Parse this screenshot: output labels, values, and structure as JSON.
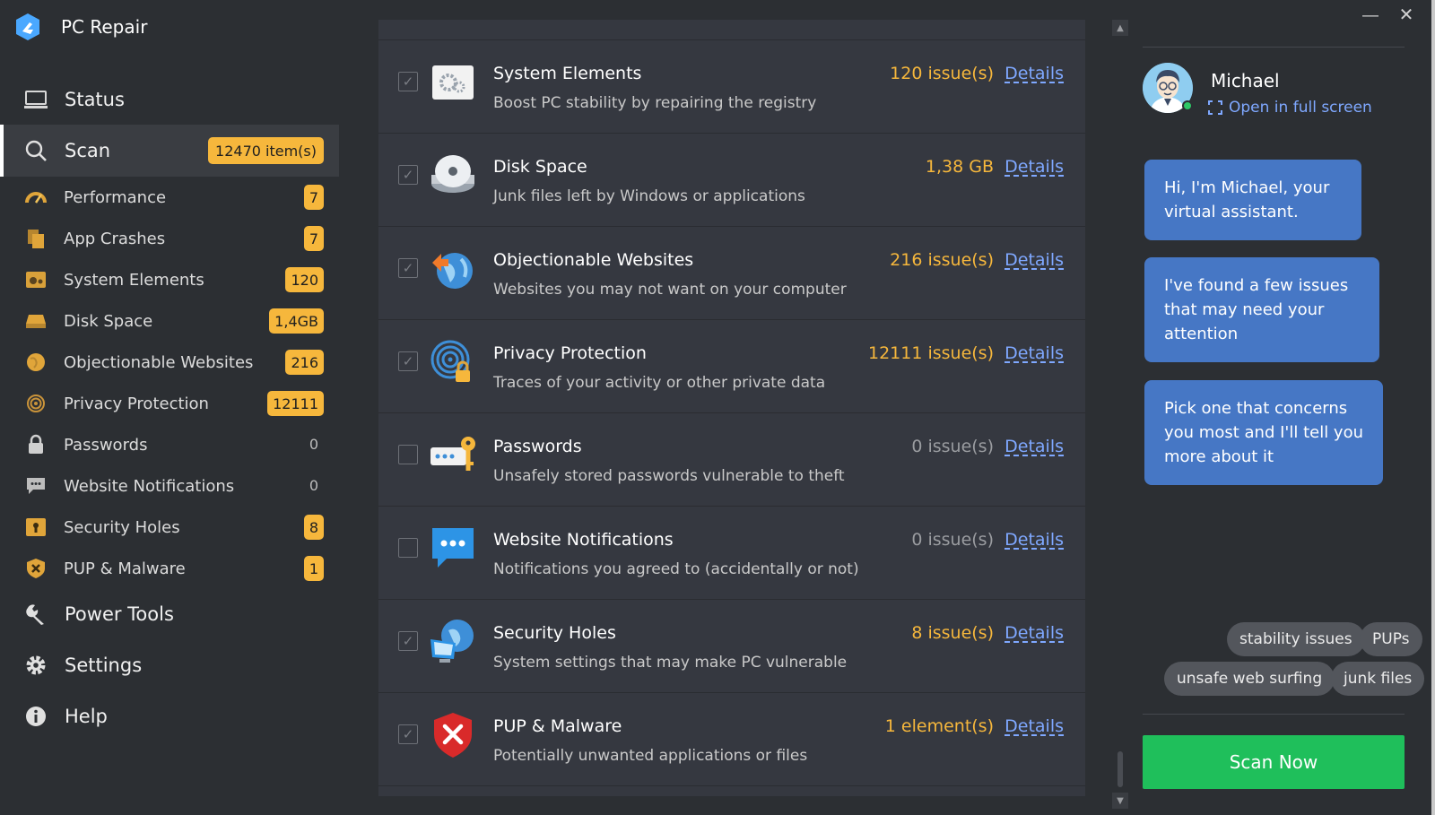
{
  "app": {
    "title": "PC Repair"
  },
  "nav": {
    "status": "Status",
    "scan": {
      "label": "Scan",
      "badge": "12470 item(s)"
    },
    "power_tools": "Power Tools",
    "settings": "Settings",
    "help": "Help"
  },
  "scan_items": [
    {
      "label": "Performance",
      "badge": "7"
    },
    {
      "label": "App Crashes",
      "badge": "7"
    },
    {
      "label": "System Elements",
      "badge": "120"
    },
    {
      "label": "Disk Space",
      "badge": "1,4GB"
    },
    {
      "label": "Objectionable Websites",
      "badge": "216"
    },
    {
      "label": "Privacy Protection",
      "badge": "12111"
    },
    {
      "label": "Passwords",
      "count": "0"
    },
    {
      "label": "Website Notifications",
      "count": "0"
    },
    {
      "label": "Security Holes",
      "badge": "8"
    },
    {
      "label": "PUP & Malware",
      "badge": "1"
    }
  ],
  "results": [
    {
      "title": "System Elements",
      "desc": "Boost PC stability by repairing the registry",
      "count": "120 issue(s)",
      "details": "Details",
      "checked": true,
      "icon": "gears-icon"
    },
    {
      "title": "Disk Space",
      "desc": "Junk files left by Windows or applications",
      "count": "1,38 GB",
      "details": "Details",
      "checked": true,
      "icon": "disk-drive-icon"
    },
    {
      "title": "Objectionable Websites",
      "desc": "Websites you may not want on your computer",
      "count": "216 issue(s)",
      "details": "Details",
      "checked": true,
      "icon": "globe-icon"
    },
    {
      "title": "Privacy Protection",
      "desc": "Traces of your activity or other private data",
      "count": "12111 issue(s)",
      "details": "Details",
      "checked": true,
      "icon": "fingerprint-lock-icon"
    },
    {
      "title": "Passwords",
      "desc": "Unsafely stored passwords vulnerable to theft",
      "count": "0 issue(s)",
      "details": "Details",
      "checked": false,
      "icon": "password-key-icon"
    },
    {
      "title": "Website Notifications",
      "desc": "Notifications you agreed to (accidentally or not)",
      "count": "0 issue(s)",
      "details": "Details",
      "checked": false,
      "icon": "chat-bubble-icon"
    },
    {
      "title": "Security Holes",
      "desc": "System settings that may make PC vulnerable",
      "count": "8 issue(s)",
      "details": "Details",
      "checked": true,
      "icon": "globe-monitor-icon"
    },
    {
      "title": "PUP & Malware",
      "desc": "Potentially unwanted applications or files",
      "count": "1 element(s)",
      "details": "Details",
      "checked": true,
      "icon": "shield-x-icon"
    }
  ],
  "assistant": {
    "name": "Michael",
    "fullscreen": "Open in full screen",
    "messages": [
      "Hi, I'm Michael, your virtual assistant.",
      "I've found a few issues that may need your attention",
      "Pick one that concerns you most and I'll tell you more about it"
    ],
    "chips": [
      "stability issues",
      "PUPs",
      "unsafe web surfing",
      "junk files"
    ]
  },
  "actions": {
    "scan_now": "Scan Now"
  },
  "colors": {
    "accent": "#f6b73c",
    "link": "#7fa8ff",
    "bubble": "#4677c5",
    "scan_button": "#1fbf5b"
  }
}
